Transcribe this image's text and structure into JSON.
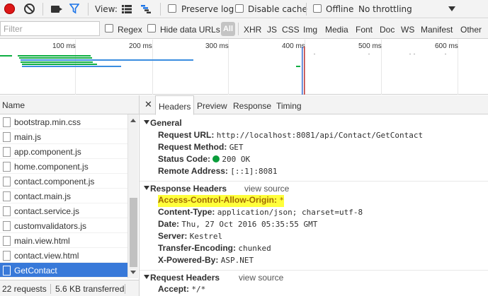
{
  "toolbar": {
    "view_label": "View:",
    "preserve_log": "Preserve log",
    "disable_cache": "Disable cache",
    "offline": "Offline",
    "throttling": "No throttling"
  },
  "filterbar": {
    "placeholder": "Filter",
    "regex": "Regex",
    "hide_data_urls": "Hide data URLs",
    "all": "All",
    "types": [
      "XHR",
      "JS",
      "CSS",
      "Img",
      "Media",
      "Font",
      "Doc",
      "WS",
      "Manifest",
      "Other"
    ]
  },
  "overview": {
    "ticks": [
      "100 ms",
      "200 ms",
      "300 ms",
      "400 ms",
      "500 ms",
      "600 ms"
    ]
  },
  "requests": {
    "column_name": "Name",
    "files": [
      "bootstrap.min.css",
      "main.js",
      "app.component.js",
      "home.component.js",
      "contact.component.js",
      "contact.main.js",
      "contact.service.js",
      "customvalidators.js",
      "main.view.html",
      "contact.view.html",
      "GetContact"
    ],
    "selected_index": 10
  },
  "status": {
    "requests": "22 requests",
    "transferred": "5.6 KB transferred"
  },
  "detail_tabs": [
    "Headers",
    "Preview",
    "Response",
    "Timing"
  ],
  "headers": {
    "general": {
      "title": "General",
      "url_key": "Request URL:",
      "url_val": "http://localhost:8081/api/Contact/GetContact",
      "method_key": "Request Method:",
      "method_val": "GET",
      "status_key": "Status Code:",
      "status_val": "200 OK",
      "remote_key": "Remote Address:",
      "remote_val": "[::1]:8081"
    },
    "response": {
      "title": "Response Headers",
      "view_source": "view source",
      "acao_key": "Access-Control-Allow-Origin:",
      "acao_val": "*",
      "ct_key": "Content-Type:",
      "ct_val": "application/json; charset=utf-8",
      "date_key": "Date:",
      "date_val": "Thu, 27 Oct 2016 05:35:55 GMT",
      "server_key": "Server:",
      "server_val": "Kestrel",
      "te_key": "Transfer-Encoding:",
      "te_val": "chunked",
      "xpb_key": "X-Powered-By:",
      "xpb_val": "ASP.NET"
    },
    "request": {
      "title": "Request Headers",
      "view_source": "view source",
      "accept_key": "Accept:",
      "accept_val": "*/*"
    }
  },
  "colors": {
    "record": "#dd1717",
    "selected_row": "#3879d9",
    "highlight": "#ffff3b",
    "status_ok": "#0a9d3b"
  }
}
